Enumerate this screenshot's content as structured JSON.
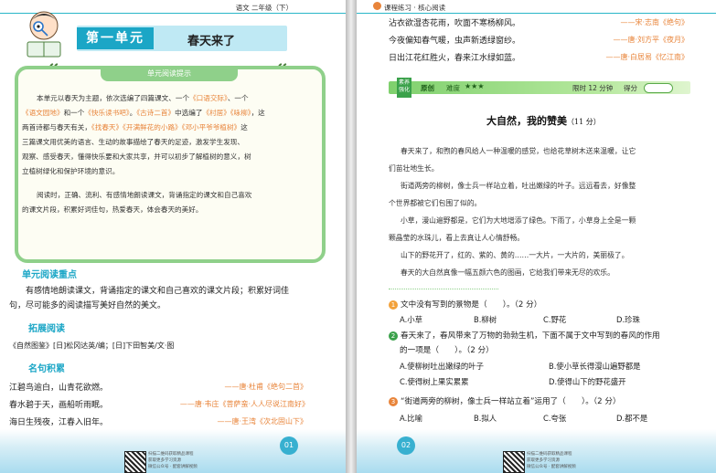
{
  "left": {
    "header": "语文 二年级（下）",
    "unit_label": "第一单元",
    "unit_title": "春天来了",
    "tip_title": "单元阅读提示",
    "tip_lines": [
      {
        "segs": [
          {
            "t": "本单元以春天为主题，依次选编了四篇课文、一个",
            "o": false
          },
          {
            "t": "《口语交际》",
            "o": true
          },
          {
            "t": "、一个",
            "o": false
          }
        ]
      },
      {
        "segs": [
          {
            "t": "《语文园地》",
            "o": true
          },
          {
            "t": "和一个",
            "o": false
          },
          {
            "t": "《快乐读书吧》",
            "o": true
          },
          {
            "t": "。",
            "o": false
          },
          {
            "t": "《古诗二首》",
            "o": true
          },
          {
            "t": "中选编了",
            "o": false
          },
          {
            "t": "《村居》",
            "o": true
          },
          {
            "t": "《咏柳》",
            "o": true
          },
          {
            "t": "，这",
            "o": false
          }
        ]
      },
      {
        "segs": [
          {
            "t": "两首诗都与春天有关，",
            "o": false
          },
          {
            "t": "《找春天》",
            "o": true
          },
          {
            "t": "《开满鲜花的小路》",
            "o": true
          },
          {
            "t": "《邓小平爷爷植树》",
            "o": true
          },
          {
            "t": "这",
            "o": false
          }
        ]
      },
      {
        "segs": [
          {
            "t": "三篇课文用优美的语言、生动的故事描绘了春天的足迹，激发学生发现、",
            "o": false
          }
        ]
      },
      {
        "segs": [
          {
            "t": "观察、感受春天，懂得快乐要和大家共享，并可以初步了解植树的意义，树",
            "o": false
          }
        ]
      },
      {
        "segs": [
          {
            "t": "立植树绿化和保护环境的意识。",
            "o": false
          }
        ]
      },
      {
        "segs": [
          {
            "t": "阅读时，正确、流利、有感情地朗读课文，背诵指定的课文和自己喜欢",
            "o": false
          }
        ]
      },
      {
        "segs": [
          {
            "t": "的课文片段，积累好词佳句，热爱春天，体会春天的美好。",
            "o": false
          }
        ]
      }
    ],
    "focus_heading": "单元阅读重点",
    "focus_lines": [
      "有感情地朗读课文，背诵指定的课文和自己喜欢的课文片段；积累好词佳",
      "句，尽可能多的阅读描写美好自然的美文。"
    ],
    "ext_heading": "拓展阅读",
    "ext_text": "《自然图鉴》[日]松冈达英/编；[日]下田智美/文·图",
    "quotes_heading": "名句积累",
    "quotes": [
      {
        "line": "江碧鸟逾白，山青花欲燃。",
        "src": "——唐·杜甫《绝句二首》"
      },
      {
        "line": "春水碧于天，画船听雨眠。",
        "src": "——唐·韦庄《菩萨蛮·人人尽说江南好》"
      },
      {
        "line": "海日生残夜，江春入旧年。",
        "src": "——唐·王湾《次北固山下》"
      }
    ],
    "page_num": "01",
    "footer_lines": [
      "扫描二维码获取精品课程",
      "获取更多学习资源",
      "微信公众号 · 配套讲解视频"
    ]
  },
  "right": {
    "header": "课程练习 · 核心阅读",
    "poems": [
      {
        "line": "沾衣欲湿杏花雨，吹面不寒杨柳风。",
        "src": "——宋·志南《绝句》"
      },
      {
        "line": "今夜偏知春气暖，虫声新透绿窗纱。",
        "src": "——唐·刘方平《夜月》"
      },
      {
        "line": "日出江花红胜火，春来江水绿如蓝。",
        "src": "——唐·白居易《忆江南》"
      }
    ],
    "badge": "素养强化",
    "tag_original": "原创",
    "difficulty_label": "难度",
    "difficulty_stars": "★★★",
    "time_label": "限时 12 分钟",
    "score_label": "得分",
    "article_title": "大自然，我的赞美",
    "article_points": "（11 分）",
    "paragraphs": [
      [
        "春天来了，和煦的春风给人一种温暖的感觉，也给花草树木送来温暖，让它",
        "们苗壮地生长。"
      ],
      [
        "街道两旁的柳树，像士兵一样站立着，吐出嫩绿的叶子。远远看去，好像整",
        "个世界都被它们包围了似的。"
      ],
      [
        "小草，漫山遍野都是，它们为大地增添了绿色。下雨了，小草身上全是一颗",
        "颗晶莹的水珠儿，看上去真让人心情舒畅。"
      ],
      [
        "山下的野花开了，红的、紫的、黄的……一大片，一大片的，美丽极了。"
      ],
      [
        "春天的大自然真像一幅五颜六色的图画，它给我们带来无尽的欢乐。"
      ]
    ],
    "questions": [
      {
        "num": "1",
        "color": "#f2a13a",
        "text": [
          "文中没有写到的景物是（　　）。（2 分）"
        ],
        "options": [
          "A.小草",
          "B.柳树",
          "C.野花",
          "D.珍珠"
        ]
      },
      {
        "num": "2",
        "color": "#3aa14a",
        "text": [
          "春天来了，春风带来了万物的勃勃生机，下面不属于文中写到的春风的作用",
          "的一项是（　　）。（2 分）"
        ],
        "options": [
          "A.使柳树吐出嫩绿的叶子",
          "B.使小草长得漫山遍野都是",
          "C.使得树上果实累累",
          "D.使得山下的野花盛开"
        ]
      },
      {
        "num": "3",
        "color": "#e8843a",
        "text": [
          "“街道两旁的柳树，像士兵一样站立着”运用了（　　）。（2 分）"
        ],
        "options": [
          "A.比喻",
          "B.拟人",
          "C.夸张",
          "D.都不是"
        ]
      }
    ],
    "page_num": "02",
    "footer_lines": [
      "扫描二维码获取精品课程",
      "获取更多学习资源",
      "微信公众号 · 配套讲解视频"
    ]
  },
  "colors": {
    "accent": "#1ba6c6",
    "orange": "#e8843a",
    "green": "#8fd08a"
  }
}
